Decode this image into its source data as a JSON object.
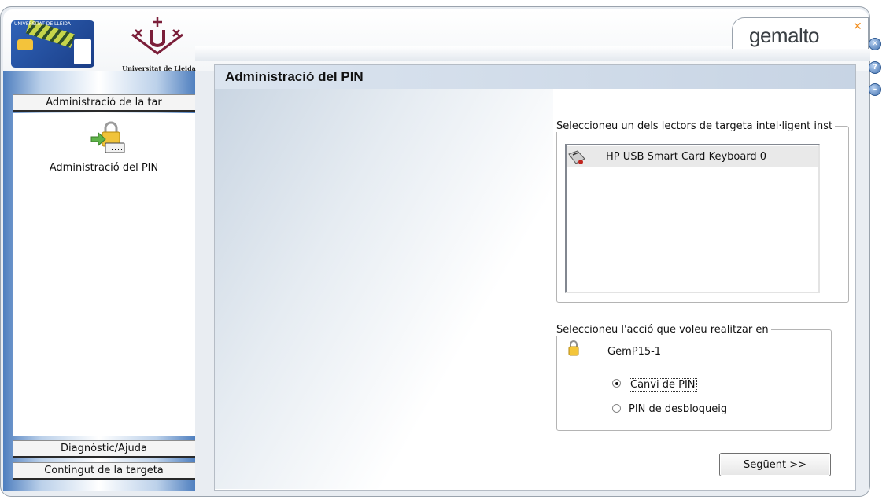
{
  "header": {
    "brand": "gemalto",
    "university_name": "Universitat de Lleida",
    "card_logo_text": "UNIVERSITAT DE LLEIDA"
  },
  "window_controls": [
    "close-icon",
    "help-icon",
    "minimize-icon"
  ],
  "sidebar": {
    "sections": [
      {
        "label": "Administració de la tar",
        "active": true
      },
      {
        "label": "Diagnòstic/Ajuda"
      },
      {
        "label": "Contingut de la targeta"
      }
    ],
    "tasks": [
      {
        "label": "Administració del PIN",
        "icon": "pin-admin-icon"
      }
    ]
  },
  "main": {
    "title": "Administració del PIN",
    "reader_group": {
      "legend": "Seleccioneu un dels lectors de targeta intel·ligent inst",
      "readers": [
        {
          "name": "HP USB Smart Card Keyboard 0",
          "icon": "card-reader-icon",
          "selected": true
        }
      ]
    },
    "action_group": {
      "legend": "Seleccioneu l'acció que voleu realitzar en",
      "card_name": "GemP15-1",
      "options": [
        {
          "label": "Canvi de PIN",
          "checked": true
        },
        {
          "label": "PIN de desbloqueig",
          "checked": false
        }
      ]
    },
    "next_button": "Següent >>"
  },
  "colors": {
    "accent_blue": "#4f7fbf",
    "header_band": "#c7d4e4",
    "brand_x": "#f28c1b"
  }
}
